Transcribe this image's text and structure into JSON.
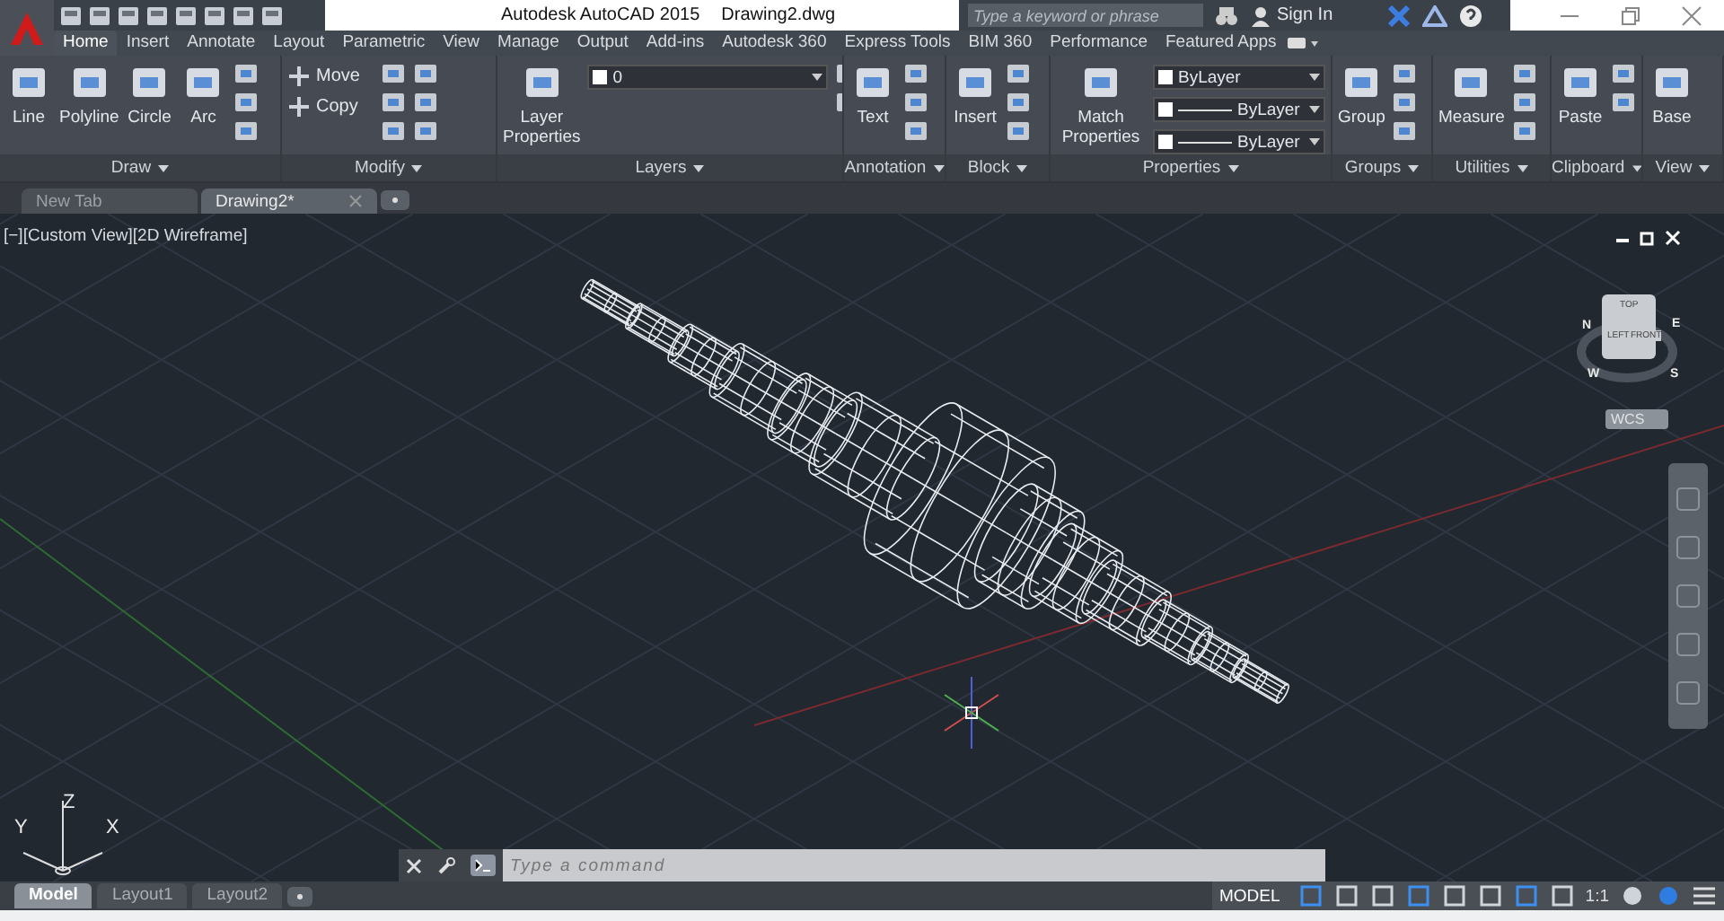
{
  "title_bar": {
    "title": "Autodesk AutoCAD 2015",
    "file": "Drawing2.dwg",
    "search": {
      "placeholder": "Type a keyword or phrase"
    },
    "sign_in": "Sign In"
  },
  "ribbon_tabs": [
    {
      "label": "Home",
      "selected": true
    },
    {
      "label": "Insert",
      "selected": false
    },
    {
      "label": "Annotate",
      "selected": false
    },
    {
      "label": "Layout",
      "selected": false
    },
    {
      "label": "Parametric",
      "selected": false
    },
    {
      "label": "View",
      "selected": false
    },
    {
      "label": "Manage",
      "selected": false
    },
    {
      "label": "Output",
      "selected": false
    },
    {
      "label": "Add-ins",
      "selected": false
    },
    {
      "label": "Autodesk 360",
      "selected": false
    },
    {
      "label": "Express Tools",
      "selected": false
    },
    {
      "label": "BIM 360",
      "selected": false
    },
    {
      "label": "Performance",
      "selected": false
    },
    {
      "label": "Featured Apps",
      "selected": false
    }
  ],
  "panels": [
    {
      "title": "Draw",
      "tools": [
        {
          "kind": "large",
          "label": "Line"
        },
        {
          "kind": "large",
          "label": "Polyline"
        },
        {
          "kind": "large",
          "label": "Circle"
        },
        {
          "kind": "large",
          "label": "Arc"
        }
      ]
    },
    {
      "title": "Modify",
      "tools": [
        {
          "kind": "small",
          "label": "Move"
        },
        {
          "kind": "small",
          "label": "Copy"
        }
      ]
    },
    {
      "title": "Layers",
      "tools": [
        {
          "kind": "large",
          "label": "Layer Properties"
        },
        {
          "kind": "dropdown",
          "value": "0"
        }
      ]
    },
    {
      "title": "Annotation",
      "tools": [
        {
          "kind": "large",
          "label": "Text"
        }
      ]
    },
    {
      "title": "Block",
      "tools": [
        {
          "kind": "large",
          "label": "Insert"
        }
      ]
    },
    {
      "title": "Properties",
      "tools": [
        {
          "kind": "large",
          "label": "Match Properties"
        },
        {
          "kind": "dropdown",
          "value": "ByLayer"
        },
        {
          "kind": "dropdown",
          "value": "ByLayer"
        },
        {
          "kind": "dropdown",
          "value": "ByLayer"
        }
      ]
    },
    {
      "title": "Groups",
      "tools": [
        {
          "kind": "large",
          "label": "Group"
        }
      ]
    },
    {
      "title": "Utilities",
      "tools": [
        {
          "kind": "large",
          "label": "Measure"
        }
      ]
    },
    {
      "title": "Clipboard",
      "tools": [
        {
          "kind": "large",
          "label": "Paste"
        }
      ]
    },
    {
      "title": "View",
      "tools": [
        {
          "kind": "large",
          "label": "Base"
        }
      ]
    }
  ],
  "doc_tabs": [
    {
      "label": "New Tab",
      "selected": false
    },
    {
      "label": "Drawing2*",
      "selected": true
    }
  ],
  "viewport": {
    "label": "[−][Custom View][2D Wireframe]",
    "viewcube": {
      "faces": [
        "TOP",
        "LEFT",
        "FRONT"
      ],
      "compass": [
        "N",
        "E",
        "W",
        "S"
      ],
      "ucs": "WCS"
    },
    "axes": [
      "Y",
      "Z",
      "X"
    ]
  },
  "command_line": {
    "placeholder": "Type a command"
  },
  "layout_tabs": [
    {
      "label": "Model",
      "selected": true
    },
    {
      "label": "Layout1",
      "selected": false
    },
    {
      "label": "Layout2",
      "selected": false
    }
  ],
  "status_bar": {
    "space": "MODEL",
    "scale": "1:1"
  }
}
